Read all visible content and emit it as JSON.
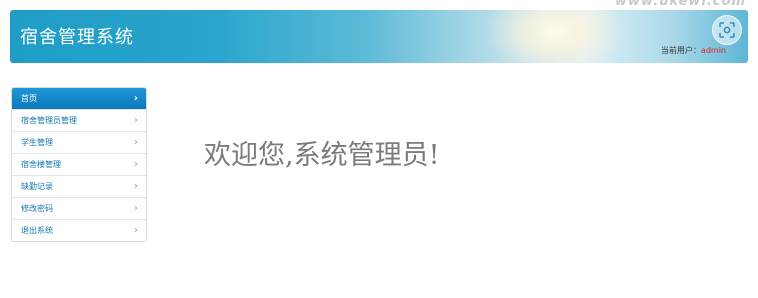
{
  "watermark": "www.ukewl.com",
  "header": {
    "title": "宿舍管理系统",
    "current_user_label": "当前用户：",
    "current_user_name": "admin",
    "corner_icon": "scan-icon"
  },
  "sidebar": {
    "items": [
      {
        "label": "首页",
        "active": true
      },
      {
        "label": "宿舍管理员管理",
        "active": false
      },
      {
        "label": "学生管理",
        "active": false
      },
      {
        "label": "宿舍楼管理",
        "active": false
      },
      {
        "label": "缺勤记录",
        "active": false
      },
      {
        "label": "修改密码",
        "active": false
      },
      {
        "label": "退出系统",
        "active": false
      }
    ],
    "chevron": "›"
  },
  "main": {
    "welcome": "欢迎您,系统管理员!"
  },
  "colors": {
    "accent": "#0b79bd",
    "link": "#1479b0",
    "username": "#e0201b"
  }
}
